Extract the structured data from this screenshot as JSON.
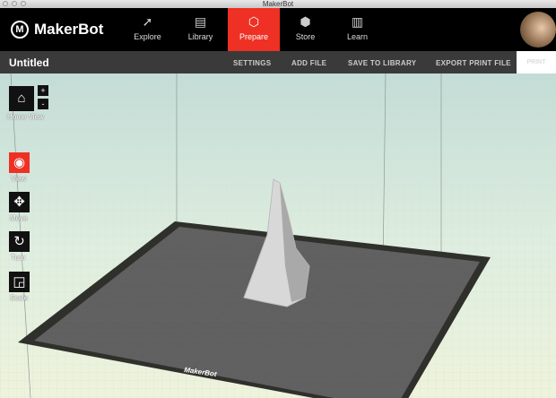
{
  "window": {
    "title": "MakerBot"
  },
  "brand": {
    "name": "MakerBot",
    "accent": "#ee3124"
  },
  "nav": [
    {
      "label": "Explore",
      "icon": "compass-icon"
    },
    {
      "label": "Library",
      "icon": "library-icon"
    },
    {
      "label": "Prepare",
      "icon": "prepare-icon",
      "active": true
    },
    {
      "label": "Store",
      "icon": "cube-icon"
    },
    {
      "label": "Learn",
      "icon": "book-icon"
    }
  ],
  "document": {
    "title": "Untitled"
  },
  "actions": {
    "settings": "SETTINGS",
    "add_file": "ADD FILE",
    "save": "SAVE TO LIBRARY",
    "export": "EXPORT PRINT FILE",
    "print": "PRINT"
  },
  "tools": {
    "home": "Home View",
    "zoom_in": "+",
    "zoom_out": "-",
    "view": "View",
    "move": "Move",
    "turn": "Turn",
    "scale": "Scale"
  },
  "plate": {
    "label": "MakerBot"
  }
}
